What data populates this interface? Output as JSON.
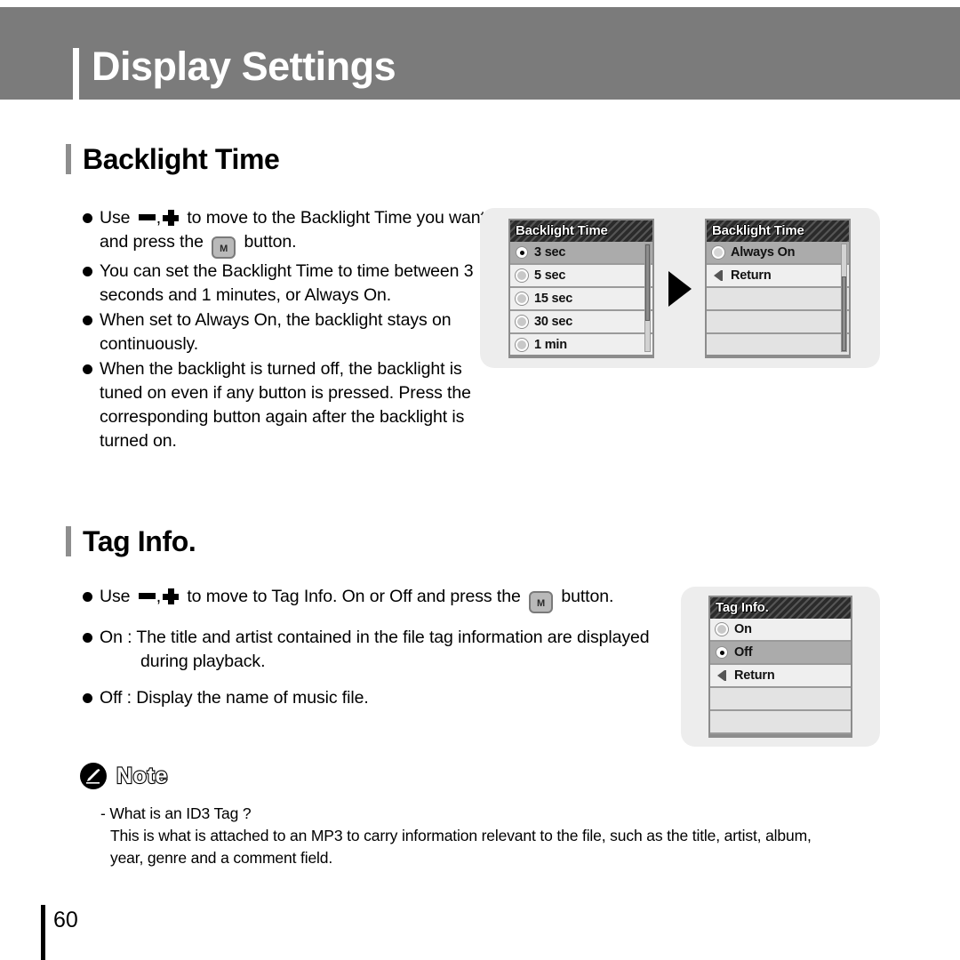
{
  "header": {
    "title": "Display Settings"
  },
  "sections": [
    {
      "id": "backlight",
      "heading": "Backlight Time",
      "bullets": [
        {
          "pre": "Use ",
          "icons": [
            "minus-icon",
            "plus-icon"
          ],
          "mid": " to move to the Backlight Time you want and press the ",
          "button": "M",
          "post": " button."
        },
        {
          "text": "You can set the Backlight Time to time between 3 seconds and 1 minutes, or Always On."
        },
        {
          "text": "When set to Always On, the backlight stays on continuously."
        },
        {
          "text": "When the backlight is turned off, the backlight is tuned on even if any button is pressed. Press the corresponding button again after the backlight is turned on."
        }
      ]
    },
    {
      "id": "taginfo",
      "heading": "Tag Info.",
      "bullets": [
        {
          "pre": "Use ",
          "icons": [
            "minus-icon",
            "plus-icon"
          ],
          "mid": " to move to Tag Info. On or Off and press the ",
          "button": "M",
          "post": " button."
        },
        {
          "text": "On : The title and artist contained in the file tag information are displayed",
          "sub": "during playback."
        },
        {
          "text": "Off : Display the name of music file."
        }
      ]
    }
  ],
  "screens": {
    "backlight_a": {
      "title": "Backlight Time",
      "rows": [
        {
          "label": "3 sec",
          "marker": "radio-on",
          "selected": true
        },
        {
          "label": "5 sec",
          "marker": "radio-off",
          "selected": false
        },
        {
          "label": "15 sec",
          "marker": "radio-off",
          "selected": false
        },
        {
          "label": "30 sec",
          "marker": "radio-off",
          "selected": false
        },
        {
          "label": "1 min",
          "marker": "radio-off",
          "selected": false
        }
      ],
      "scrollbar": {
        "thumb_top_pct": 0,
        "thumb_height_pct": 72
      }
    },
    "backlight_b": {
      "title": "Backlight Time",
      "rows": [
        {
          "label": "Always On",
          "marker": "radio-hollow",
          "selected": true
        },
        {
          "label": "Return",
          "marker": "return-icon",
          "selected": false
        },
        {
          "label": "",
          "marker": "none",
          "selected": false,
          "empty": true
        },
        {
          "label": "",
          "marker": "none",
          "selected": false,
          "empty": true
        },
        {
          "label": "",
          "marker": "none",
          "selected": false,
          "empty": true
        }
      ],
      "scrollbar": {
        "thumb_top_pct": 30,
        "thumb_height_pct": 70
      }
    },
    "taginfo": {
      "title": "Tag Info.",
      "rows": [
        {
          "label": "On",
          "marker": "radio-off",
          "selected": false
        },
        {
          "label": "Off",
          "marker": "radio-on",
          "selected": true
        },
        {
          "label": "Return",
          "marker": "return-icon",
          "selected": false
        },
        {
          "label": "",
          "marker": "none",
          "selected": false,
          "empty": true
        },
        {
          "label": "",
          "marker": "none",
          "selected": false,
          "empty": true
        }
      ],
      "scrollbar": null
    }
  },
  "flow_arrow": "play-triangle-icon",
  "note": {
    "icon": "note-pencil-icon",
    "label": "Note",
    "line1": "- What is an ID3 Tag ?",
    "line2": "This is what is attached to an MP3 to carry information relevant to the file, such as the title, artist, album, year, genre and a comment field."
  },
  "footer": {
    "page_number": "60"
  },
  "colors": {
    "header_band": "#7b7b7b",
    "section_bar": "#8e8e8e",
    "lcd_titlebar": "#2b2b2b",
    "lcd_row": "#efefef",
    "lcd_row_selected": "#ababab",
    "tray": "#ededed"
  }
}
